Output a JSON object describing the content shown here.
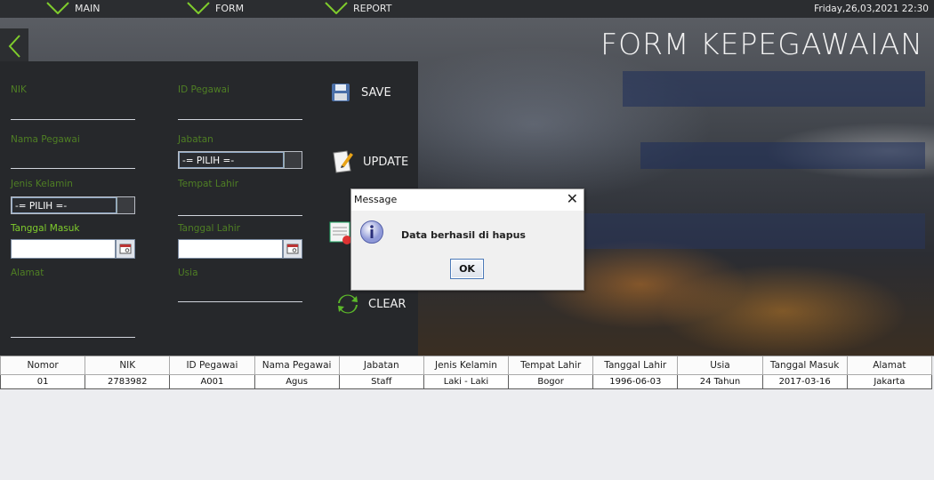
{
  "menu": {
    "items": [
      {
        "label": "MAIN"
      },
      {
        "label": "FORM"
      },
      {
        "label": "REPORT"
      }
    ],
    "datetime": "Friday,26,03,2021   22:30"
  },
  "header": {
    "title": "FORM KEPEGAWAIAN"
  },
  "form": {
    "nik_label": "NIK",
    "id_pegawai_label": "ID Pegawai",
    "nama_label": "Nama Pegawai",
    "jabatan_label": "Jabatan",
    "jabatan_value": "-= PILIH =-",
    "jenis_kelamin_label": "Jenis Kelamin",
    "jenis_kelamin_value": "-= PILIH =-",
    "tempat_lahir_label": "Tempat Lahir",
    "tanggal_masuk_label": "Tanggal Masuk",
    "tanggal_lahir_label": "Tanggal Lahir",
    "alamat_label": "Alamat",
    "usia_label": "Usia"
  },
  "actions": {
    "save": "SAVE",
    "update": "UPDATE",
    "clear": "CLEAR"
  },
  "table": {
    "headers": [
      "Nomor",
      "NIK",
      "ID Pegawai",
      "Nama Pegawai",
      "Jabatan",
      "Jenis Kelamin",
      "Tempat Lahir",
      "Tanggal Lahir",
      "Usia",
      "Tanggal Masuk",
      "Alamat"
    ],
    "rows": [
      [
        "01",
        "2783982",
        "A001",
        "Agus",
        "Staff",
        "Laki - Laki",
        "Bogor",
        "1996-06-03",
        "24 Tahun",
        "2017-03-16",
        "Jakarta"
      ]
    ]
  },
  "dialog": {
    "title": "Message",
    "message": "Data berhasil di hapus",
    "ok": "OK"
  },
  "colors": {
    "label_green": "#4f7f24",
    "active_green": "#7fcc2c"
  }
}
